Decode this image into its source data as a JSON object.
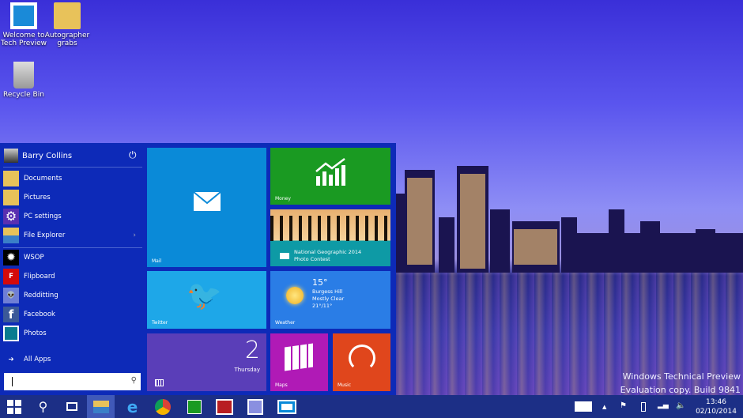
{
  "desktop": {
    "icons": [
      {
        "label": "Welcome to Tech Preview",
        "icon": "windows-logo-icon"
      },
      {
        "label": "Autographer grabs",
        "icon": "folder-icon"
      },
      {
        "label": "Recycle Bin",
        "icon": "recycle-bin-icon"
      }
    ],
    "watermark": {
      "line1": "Windows Technical Preview",
      "line2": "Evaluation copy. Build 9841"
    }
  },
  "start_menu": {
    "user": "Barry Collins",
    "places": [
      {
        "label": "Documents",
        "icon": "folder-icon"
      },
      {
        "label": "Pictures",
        "icon": "folder-icon"
      },
      {
        "label": "PC settings",
        "icon": "gear-icon"
      },
      {
        "label": "File Explorer",
        "icon": "file-explorer-icon"
      }
    ],
    "apps": [
      {
        "label": "WSOP",
        "color": "#000000"
      },
      {
        "label": "Flipboard",
        "color": "#d40a0a"
      },
      {
        "label": "Redditting",
        "color": "#6f7fd6"
      },
      {
        "label": "Facebook",
        "color": "#3b5998"
      },
      {
        "label": "Photos",
        "color": "#0a7b8f"
      }
    ],
    "all_apps": "All Apps",
    "search_placeholder": "",
    "tiles": {
      "mail": {
        "label": "Mail",
        "color": "#0a8ad8"
      },
      "money": {
        "label": "Money",
        "color": "#1a9a22"
      },
      "natgeo": {
        "title": "National Geographic 2014",
        "subtitle": "Photo Contest",
        "color": "#0e9aa5"
      },
      "twitter": {
        "label": "Twitter",
        "color": "#1ea7e8"
      },
      "weather": {
        "label": "Weather",
        "temp": "15°",
        "location": "Burgess Hill",
        "condition": "Mostly Clear",
        "range": "21°/11°",
        "color": "#2a7de6"
      },
      "calendar": {
        "day_number": "2",
        "day_name": "Thursday",
        "color": "#5a3eb8"
      },
      "maps": {
        "label": "Maps",
        "color": "#b01ab6"
      },
      "music": {
        "label": "Music",
        "color": "#e0461c"
      }
    }
  },
  "taskbar": {
    "apps": [
      "start",
      "search",
      "task-view",
      "file-explorer",
      "internet-explorer",
      "chrome",
      "store",
      "news",
      "redditting",
      "mail"
    ],
    "active": "file-explorer",
    "clock": {
      "time": "13:46",
      "date": "02/10/2014"
    }
  }
}
